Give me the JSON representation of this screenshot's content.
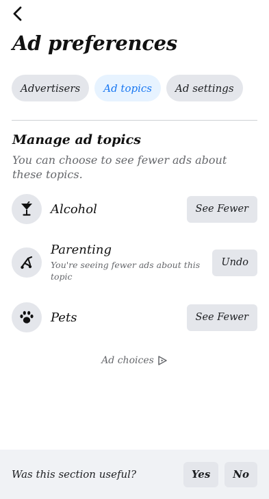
{
  "header": {
    "title": "Ad preferences"
  },
  "tabs": [
    {
      "label": "Advertisers",
      "active": false
    },
    {
      "label": "Ad topics",
      "active": true
    },
    {
      "label": "Ad settings",
      "active": false
    }
  ],
  "manage": {
    "title": "Manage ad topics",
    "description": "You can choose to see fewer ads about these topics."
  },
  "topics": [
    {
      "name": "Alcohol",
      "icon": "cocktail-icon",
      "subtitle": "",
      "action": "See Fewer"
    },
    {
      "name": "Parenting",
      "icon": "stroller-icon",
      "subtitle": "You're seeing fewer ads about this topic",
      "action": "Undo"
    },
    {
      "name": "Pets",
      "icon": "paw-icon",
      "subtitle": "",
      "action": "See Fewer"
    }
  ],
  "ad_choices": {
    "label": "Ad choices",
    "icon": "ad-choices-icon"
  },
  "feedback": {
    "question": "Was this section useful?",
    "yes_label": "Yes",
    "no_label": "No"
  },
  "colors": {
    "accent": "#1877f2",
    "active_tab_bg": "#e7f3ff",
    "button_bg": "#e4e6eb",
    "footer_bg": "#f0f2f5"
  }
}
